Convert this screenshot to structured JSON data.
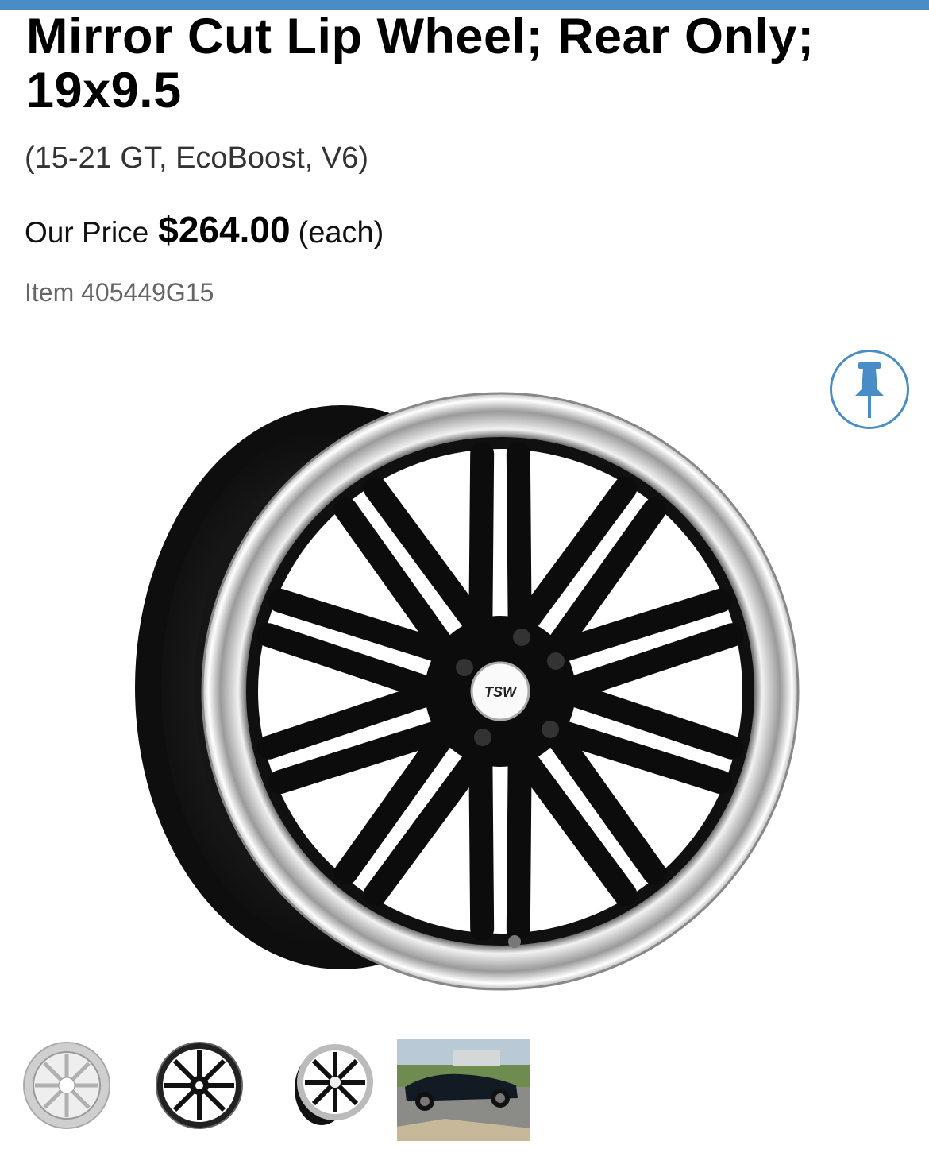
{
  "product": {
    "title": "Mirror Cut Lip Wheel; Rear Only; 19x9.5",
    "fitment": "(15-21 GT, EcoBoost, V6)",
    "price_label": "Our Price",
    "price": "$264.00",
    "price_unit": "(each)",
    "item_label": "Item",
    "item_number": "405449G15",
    "hub_logo": "TSW"
  },
  "icons": {
    "pin": "pushpin-icon"
  },
  "thumbnails": [
    {
      "name": "silver-wheel-front"
    },
    {
      "name": "black-wheel-front"
    },
    {
      "name": "black-wheel-angle"
    },
    {
      "name": "car-photo"
    }
  ],
  "colors": {
    "accent": "#4a8cc6",
    "wheel": "#111111",
    "lip": "#d9d9d9"
  }
}
